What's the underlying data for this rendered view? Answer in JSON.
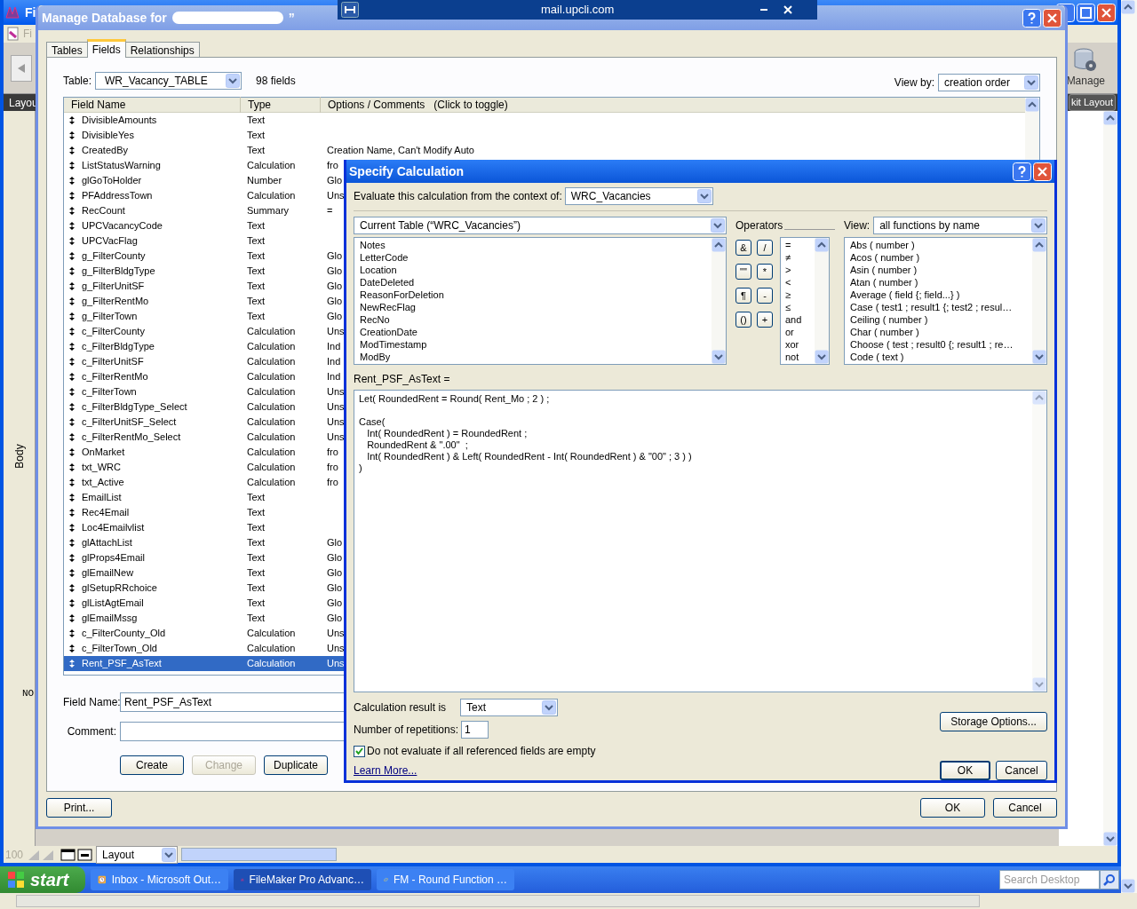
{
  "app": {
    "title": "Fi",
    "document_label": "Fi",
    "left_bar_label": "Layou",
    "manage_button": "Manage",
    "exit_layout_button": "kit Layout",
    "part_label": "Body",
    "layout_text": "NO",
    "zoom_level": "100",
    "mode_select": "Layout"
  },
  "browser_bar": {
    "title": "mail.upcli.com"
  },
  "manage_db": {
    "title": "Manage Database for",
    "title_suffix": "”",
    "tabs": [
      {
        "label": "Tables",
        "selected": false
      },
      {
        "label": "Fields",
        "selected": true
      },
      {
        "label": "Relationships",
        "selected": false
      }
    ],
    "table_label": "Table:",
    "table_value": "WR_Vacancy_TABLE",
    "field_count": "98 fields",
    "view_by_label": "View by:",
    "view_by_value": "creation order",
    "columns": [
      "Field Name",
      "Type",
      "Options / Comments   (Click to toggle)"
    ],
    "rows": [
      {
        "name": "DivisibleAmounts",
        "type": "Text",
        "selected": false
      },
      {
        "name": "DivisibleYes",
        "type": "Text",
        "selected": false
      },
      {
        "name": "CreatedBy",
        "type": "Text",
        "options": "Creation Name, Can't Modify Auto",
        "selected": false
      },
      {
        "name": "ListStatusWarning",
        "type": "Calculation",
        "options": "fro",
        "selected": false
      },
      {
        "name": "glGoToHolder",
        "type": "Number",
        "options": "Glo",
        "selected": false
      },
      {
        "name": "PFAddressTown",
        "type": "Calculation",
        "options": "Uns",
        "selected": false
      },
      {
        "name": "RecCount",
        "type": "Summary",
        "options": "=",
        "selected": false
      },
      {
        "name": "UPCVacancyCode",
        "type": "Text",
        "selected": false
      },
      {
        "name": "UPCVacFlag",
        "type": "Text",
        "selected": false
      },
      {
        "name": "g_FilterCounty",
        "type": "Text",
        "options": "Glo",
        "selected": false
      },
      {
        "name": "g_FilterBldgType",
        "type": "Text",
        "options": "Glo",
        "selected": false
      },
      {
        "name": "g_FilterUnitSF",
        "type": "Text",
        "options": "Glo",
        "selected": false
      },
      {
        "name": "g_FilterRentMo",
        "type": "Text",
        "options": "Glo",
        "selected": false
      },
      {
        "name": "g_FilterTown",
        "type": "Text",
        "options": "Glo",
        "selected": false
      },
      {
        "name": "c_FilterCounty",
        "type": "Calculation",
        "options": "Uns",
        "selected": false
      },
      {
        "name": "c_FilterBldgType",
        "type": "Calculation",
        "options": "Ind",
        "selected": false
      },
      {
        "name": "c_FilterUnitSF",
        "type": "Calculation",
        "options": "Ind",
        "selected": false
      },
      {
        "name": "c_FilterRentMo",
        "type": "Calculation",
        "options": "Ind",
        "selected": false
      },
      {
        "name": "c_FilterTown",
        "type": "Calculation",
        "options": "Uns",
        "selected": false
      },
      {
        "name": "c_FilterBldgType_Select",
        "type": "Calculation",
        "options": "Uns",
        "selected": false
      },
      {
        "name": "c_FilterUnitSF_Select",
        "type": "Calculation",
        "options": "Uns",
        "selected": false
      },
      {
        "name": "c_FilterRentMo_Select",
        "type": "Calculation",
        "options": "Uns",
        "selected": false
      },
      {
        "name": "OnMarket",
        "type": "Calculation",
        "options": "fro",
        "selected": false
      },
      {
        "name": "txt_WRC",
        "type": "Calculation",
        "options": "fro",
        "selected": false
      },
      {
        "name": "txt_Active",
        "type": "Calculation",
        "options": "fro",
        "selected": false
      },
      {
        "name": "EmailList",
        "type": "Text",
        "selected": false
      },
      {
        "name": "Rec4Email",
        "type": "Text",
        "selected": false
      },
      {
        "name": "Loc4Emailvlist",
        "type": "Text",
        "selected": false
      },
      {
        "name": "glAttachList",
        "type": "Text",
        "options": "Glo",
        "selected": false
      },
      {
        "name": "glProps4Email",
        "type": "Text",
        "options": "Glo",
        "selected": false
      },
      {
        "name": "glEmailNew",
        "type": "Text",
        "options": "Glo",
        "selected": false
      },
      {
        "name": "glSetupRRchoice",
        "type": "Text",
        "options": "Glo",
        "selected": false
      },
      {
        "name": "glListAgtEmail",
        "type": "Text",
        "options": "Glo",
        "selected": false
      },
      {
        "name": "glEmailMssg",
        "type": "Text",
        "options": "Glo",
        "selected": false
      },
      {
        "name": "c_FilterCounty_Old",
        "type": "Calculation",
        "options": "Uns",
        "selected": false
      },
      {
        "name": "c_FilterTown_Old",
        "type": "Calculation",
        "options": "Uns",
        "selected": false
      },
      {
        "name": "Rent_PSF_AsText",
        "type": "Calculation",
        "options": "Uns",
        "selected": true
      }
    ],
    "field_name_label": "Field Name:",
    "field_name_value": "Rent_PSF_AsText",
    "comment_label": "Comment:",
    "buttons": [
      {
        "label": "Create",
        "disabled": false
      },
      {
        "label": "Change",
        "disabled": true
      },
      {
        "label": "Duplicate",
        "disabled": false
      }
    ],
    "print_button": "Print...",
    "ok_button": "OK",
    "cancel_button": "Cancel"
  },
  "calc": {
    "title": "Specify Calculation",
    "context_label": "Evaluate this calculation from the context of:",
    "context_value": "WRC_Vacancies",
    "table_select": "Current Table (“WRC_Vacancies”)",
    "fields": [
      "Notes",
      "LetterCode",
      "Location",
      "DateDeleted",
      "ReasonForDeletion",
      "NewRecFlag",
      "RecNo",
      "CreationDate",
      "ModTimestamp",
      "ModBy"
    ],
    "operators_label": "Operators",
    "operator_buttons": [
      "&",
      "/",
      "\"\"",
      "*",
      "¶",
      "-",
      "()",
      "+"
    ],
    "operator_list": [
      "=",
      "≠",
      ">",
      "<",
      "≥",
      "≤",
      "and",
      "or",
      "xor",
      "not"
    ],
    "view_label": "View:",
    "view_value": "all functions by name",
    "functions": [
      "Abs ( number )",
      "Acos ( number )",
      "Asin ( number )",
      "Atan ( number )",
      "Average ( field {; field...} )",
      "Case ( test1 ; result1 {; test2 ; resul…",
      "Ceiling ( number )",
      "Char ( number )",
      "Choose ( test ; result0 {; result1 ; re…",
      "Code ( text )"
    ],
    "formula_label": "Rent_PSF_AsText =",
    "formula": "Let( RoundedRent = Round( Rent_Mo ; 2 ) ;\n\nCase(\n   Int( RoundedRent ) = RoundedRent ;\n   RoundedRent & \".00\"  ;\n   Int( RoundedRent ) & Left( RoundedRent - Int( RoundedRent ) & \"00\" ; 3 ) )\n)",
    "result_label": "Calculation result is",
    "result_value": "Text",
    "repetitions_label": "Number of repetitions:",
    "repetitions_value": "1",
    "skip_empty": {
      "label": "Do not evaluate if all referenced fields are empty",
      "checked": true
    },
    "learn_more": "Learn More...",
    "storage_button": "Storage Options...",
    "ok_button": "OK",
    "cancel_button": "Cancel"
  },
  "taskbar": {
    "start": "start",
    "tasks": [
      {
        "label": "Inbox - Microsoft Out…",
        "kind": "mail",
        "selected": false
      },
      {
        "label": "FileMaker Pro Advanc…",
        "kind": "filemaker",
        "selected": true
      },
      {
        "label": "FM - Round Function …",
        "kind": "browser",
        "selected": false
      }
    ],
    "search": {
      "placeholder": "Search Desktop"
    }
  }
}
